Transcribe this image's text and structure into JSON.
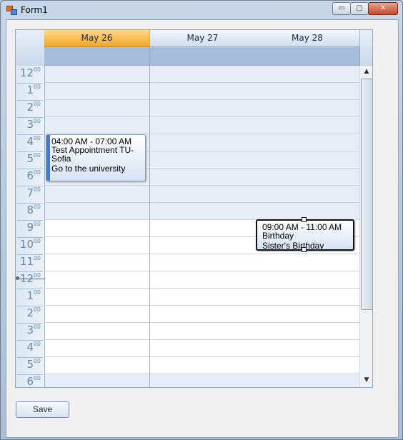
{
  "window": {
    "title": "Form1"
  },
  "controls": {
    "minimize": "▭",
    "maximize": "▢",
    "close": "✕"
  },
  "scheduler": {
    "days": [
      {
        "label": "May 26",
        "today": true
      },
      {
        "label": "May 27",
        "today": false
      },
      {
        "label": "May 28",
        "today": false
      }
    ],
    "time_slots": [
      {
        "hour": "12",
        "min": "00"
      },
      {
        "hour": "1",
        "min": "00"
      },
      {
        "hour": "2",
        "min": "00"
      },
      {
        "hour": "3",
        "min": "00"
      },
      {
        "hour": "4",
        "min": "00"
      },
      {
        "hour": "5",
        "min": "00"
      },
      {
        "hour": "6",
        "min": "00"
      },
      {
        "hour": "7",
        "min": "00"
      },
      {
        "hour": "8",
        "min": "00"
      },
      {
        "hour": "9",
        "min": "00"
      },
      {
        "hour": "10",
        "min": "00"
      },
      {
        "hour": "11",
        "min": "00"
      },
      {
        "hour": "12",
        "min": "00"
      },
      {
        "hour": "1",
        "min": "00"
      },
      {
        "hour": "2",
        "min": "00"
      },
      {
        "hour": "3",
        "min": "00"
      },
      {
        "hour": "4",
        "min": "00"
      },
      {
        "hour": "5",
        "min": "00"
      },
      {
        "hour": "6",
        "min": "00"
      }
    ],
    "appointments": [
      {
        "day": 0,
        "time": "04:00 AM - 07:00 AM",
        "subject": "Test Appointment TU-Sofia",
        "description": "Go to the university",
        "selected": false
      },
      {
        "day": 2,
        "time": "09:00 AM - 11:00 AM",
        "subject": "Birthday",
        "description": "Sister's Birthday",
        "selected": true
      }
    ],
    "scroll_up": "▲",
    "scroll_down": "▼"
  },
  "footer": {
    "save_label": "Save"
  },
  "colors": {
    "today_header": "#f5a623",
    "allday_band": "#a5bcdb",
    "appointment_bar": "#3e7bd2",
    "off_hours": "#e7edf6"
  }
}
